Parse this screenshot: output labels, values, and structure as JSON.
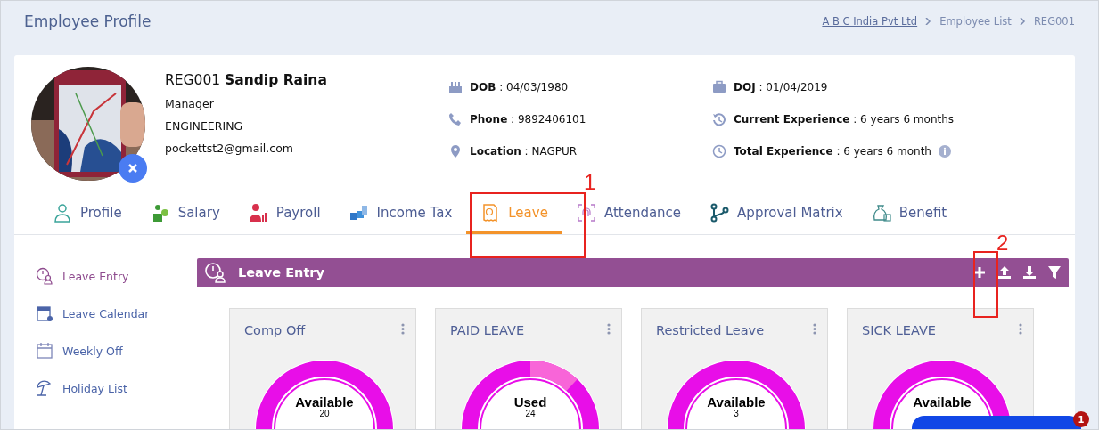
{
  "page_title": "Employee Profile",
  "breadcrumb": [
    {
      "label": "A B C India Pvt Ltd",
      "kind": "link"
    },
    {
      "label": "Employee List",
      "kind": "text"
    },
    {
      "label": "REG001",
      "kind": "text"
    }
  ],
  "employee": {
    "code": "REG001",
    "name": "Sandip Raina",
    "designation": "Manager",
    "department": "ENGINEERING",
    "email": "pockettst2@gmail.com"
  },
  "details_left": [
    {
      "kind": "cake",
      "label": "DOB",
      "value": ": 04/03/1980"
    },
    {
      "kind": "phone",
      "label": "Phone",
      "value": ": 9892406101"
    },
    {
      "kind": "pin",
      "label": "Location",
      "value": ": NAGPUR"
    }
  ],
  "details_right": [
    {
      "kind": "briefcase",
      "label": "DOJ",
      "value": ": 01/04/2019",
      "info": false
    },
    {
      "kind": "history",
      "label": "Current Experience",
      "value": ": 6 years 6 months",
      "info": false
    },
    {
      "kind": "clock",
      "label": "Total Experience",
      "value": ": 6 years 6 month",
      "info": true
    }
  ],
  "tabs": [
    {
      "label": "Profile",
      "kind": "person",
      "selected": false
    },
    {
      "label": "Salary",
      "kind": "salary",
      "selected": false
    },
    {
      "label": "Payroll",
      "kind": "payroll",
      "selected": false
    },
    {
      "label": "Income Tax",
      "kind": "tax",
      "selected": false
    },
    {
      "label": "Leave",
      "kind": "leave",
      "selected": true
    },
    {
      "label": "Attendance",
      "kind": "fingerprint",
      "selected": false
    },
    {
      "label": "Approval Matrix",
      "kind": "flow",
      "selected": false
    },
    {
      "label": "Benefit",
      "kind": "money",
      "selected": false
    }
  ],
  "sidebar": [
    {
      "label": "Leave Entry",
      "kind": "leave",
      "selected": true
    },
    {
      "label": "Leave Calendar",
      "kind": "calendar",
      "selected": false
    },
    {
      "label": "Weekly Off",
      "kind": "week",
      "selected": false
    },
    {
      "label": "Holiday List",
      "kind": "beach",
      "selected": false
    }
  ],
  "panel": {
    "title": "Leave Entry",
    "actions": [
      {
        "kind": "add"
      },
      {
        "kind": "upload"
      },
      {
        "kind": "download"
      },
      {
        "kind": "filter"
      }
    ]
  },
  "leave_cards": [
    {
      "title": "Comp Off",
      "label": "Available",
      "value": "20",
      "kind": "single"
    },
    {
      "title": "PAID LEAVE",
      "label": "Used",
      "value": "24",
      "kind": "split"
    },
    {
      "title": "Restricted Leave",
      "label": "Available",
      "value": "3",
      "kind": "single"
    },
    {
      "title": "SICK LEAVE",
      "label": "Available",
      "kind": "single"
    }
  ],
  "annotations": [
    {
      "label": "1"
    },
    {
      "label": "2"
    }
  ],
  "chat": {
    "badge": "1"
  }
}
